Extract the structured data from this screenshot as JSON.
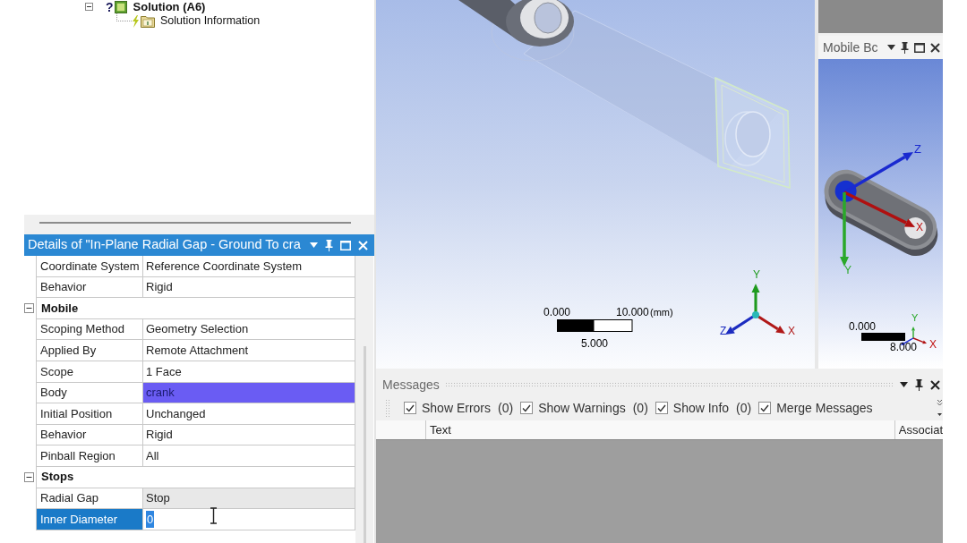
{
  "tree": {
    "items": [
      {
        "label": "Solution (A6)",
        "status_mark": "?",
        "expanded": true,
        "children": [
          {
            "label": "Solution Information"
          }
        ]
      }
    ]
  },
  "details": {
    "title": "Details of \"In-Plane Radial Gap - Ground To cra",
    "rows": [
      {
        "kind": "property",
        "name": "Coordinate System",
        "value": "Reference Coordinate System",
        "selected": false,
        "highlighted": false,
        "read_only": false,
        "editing": false
      },
      {
        "kind": "property",
        "name": "Behavior",
        "value": "Rigid",
        "selected": false,
        "highlighted": false,
        "read_only": false,
        "editing": false
      },
      {
        "kind": "group",
        "name": "Mobile",
        "expanded": true,
        "selected": false
      },
      {
        "kind": "property",
        "name": "Scoping Method",
        "value": "Geometry Selection",
        "selected": false,
        "highlighted": false,
        "read_only": false,
        "editing": false
      },
      {
        "kind": "property",
        "name": "Applied By",
        "value": "Remote Attachment",
        "selected": false,
        "highlighted": false,
        "read_only": false,
        "editing": false
      },
      {
        "kind": "property",
        "name": "Scope",
        "value": "1 Face",
        "selected": false,
        "highlighted": false,
        "read_only": false,
        "editing": false
      },
      {
        "kind": "property",
        "name": "Body",
        "value": "crank",
        "selected": false,
        "highlighted": true,
        "read_only": false,
        "editing": false
      },
      {
        "kind": "property",
        "name": "Initial Position",
        "value": "Unchanged",
        "selected": false,
        "highlighted": false,
        "read_only": false,
        "editing": false
      },
      {
        "kind": "property",
        "name": "Behavior",
        "value": "Rigid",
        "selected": false,
        "highlighted": false,
        "read_only": false,
        "editing": false
      },
      {
        "kind": "property",
        "name": "Pinball Region",
        "value": "All",
        "selected": false,
        "highlighted": false,
        "read_only": false,
        "editing": false
      },
      {
        "kind": "group",
        "name": "Stops",
        "expanded": true,
        "selected": false
      },
      {
        "kind": "property",
        "name": "Radial Gap",
        "value": "Stop",
        "selected": false,
        "highlighted": false,
        "read_only": true,
        "editing": false
      },
      {
        "kind": "property",
        "name": "Inner Diameter",
        "value": "0",
        "selected": true,
        "highlighted": false,
        "read_only": false,
        "editing": true
      }
    ]
  },
  "viewport": {
    "scale_bar": {
      "start": "0.000",
      "end": "10.000",
      "unit": "(mm)",
      "middle": "5.000"
    },
    "triad": {
      "x": "X",
      "y": "Y",
      "z": "Z"
    }
  },
  "preview": {
    "title": "Mobile Bc",
    "axes": {
      "x": "X",
      "y": "Y",
      "z": "Z"
    },
    "scale_bar": {
      "start": "0.000",
      "end": "8.000"
    },
    "triad": {
      "x": "X",
      "y": "Y"
    }
  },
  "messages": {
    "title": "Messages",
    "filters": [
      {
        "label": "Show Errors",
        "count": "(0)",
        "checked": true
      },
      {
        "label": "Show Warnings",
        "count": "(0)",
        "checked": true
      },
      {
        "label": "Show Info",
        "count": "(0)",
        "checked": true
      },
      {
        "label": "Merge Messages",
        "checked": true
      }
    ],
    "columns": [
      "Text",
      "Associat"
    ]
  }
}
